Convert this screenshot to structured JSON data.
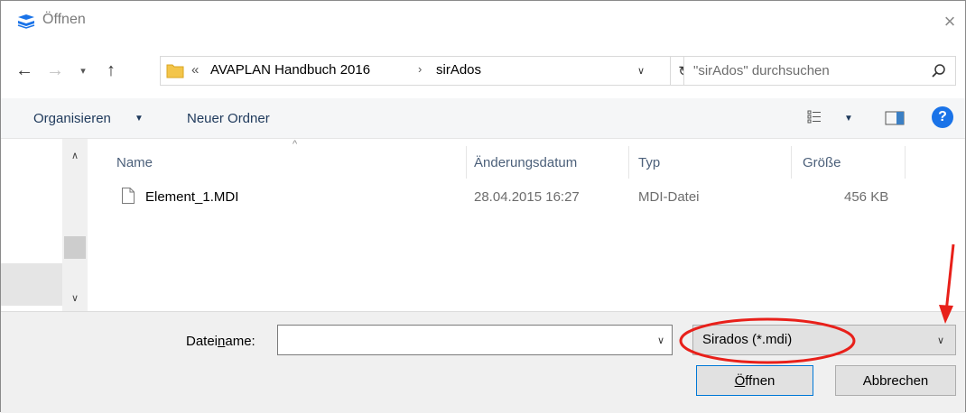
{
  "window": {
    "title": "Öffnen",
    "close_glyph": "×"
  },
  "navigation": {
    "back_glyph": "←",
    "forward_glyph": "→",
    "recent_glyph": "▾",
    "up_glyph": "↑",
    "breadcrumb_chevron": "«",
    "breadcrumb": [
      "AVAPLAN Handbuch 2016",
      "sirAdos"
    ],
    "breadcrumb_separator": "›",
    "dropdown_glyph": "∨",
    "refresh_glyph": "↻",
    "search_placeholder": "\"sirAdos\" durchsuchen"
  },
  "toolbar": {
    "organize_label": "Organisieren",
    "organize_arrow": "▼",
    "new_folder_label": "Neuer Ordner",
    "view_arrow": "▼",
    "help_glyph": "?"
  },
  "nav_pane": {
    "scroll_up_glyph": "∧",
    "scroll_down_glyph": "∨"
  },
  "file_list": {
    "sort_glyph": "^",
    "columns": [
      "Name",
      "Änderungsdatum",
      "Typ",
      "Größe"
    ],
    "rows": [
      {
        "name": "Element_1.MDI",
        "date": "28.04.2015 16:27",
        "type": "MDI-Datei",
        "size": "456 KB"
      }
    ]
  },
  "footer": {
    "filename_label_pre": "Datei",
    "filename_label_u": "n",
    "filename_label_post": "ame:",
    "filename_value": "",
    "filename_dropdown_glyph": "∨",
    "filetype_selected": "Sirados (*.mdi)",
    "filetype_dropdown_glyph": "∨",
    "open_label_u": "Ö",
    "open_label_post": "ffnen",
    "cancel_label": "Abbrechen"
  },
  "colors": {
    "accent": "#0078d7",
    "annotation": "#e8201a",
    "help": "#1a73e8"
  }
}
